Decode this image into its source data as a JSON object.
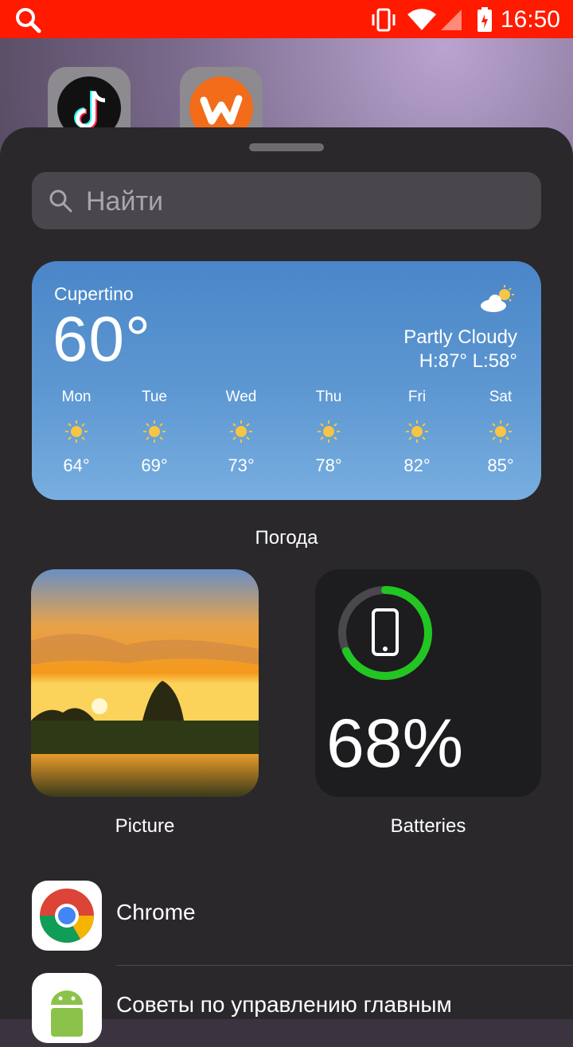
{
  "status_bar": {
    "time": "16:50"
  },
  "search": {
    "placeholder": "Найти"
  },
  "weather": {
    "city": "Cupertino",
    "temp": "60°",
    "condition": "Partly Cloudy",
    "high_low": "H:87° L:58°",
    "forecast": [
      {
        "day": "Mon",
        "temp": "64°"
      },
      {
        "day": "Tue",
        "temp": "69°"
      },
      {
        "day": "Wed",
        "temp": "73°"
      },
      {
        "day": "Thu",
        "temp": "78°"
      },
      {
        "day": "Fri",
        "temp": "82°"
      },
      {
        "day": "Sat",
        "temp": "85°"
      }
    ],
    "label": "Погода"
  },
  "widgets": {
    "picture_label": "Picture",
    "battery_label": "Batteries",
    "battery_percent": "68%",
    "battery_level": 0.68
  },
  "apps": [
    {
      "name": "Chrome"
    },
    {
      "name": "Советы по управлению главным"
    }
  ],
  "colors": {
    "status_bar": "#ff1a00",
    "battery_ring": "#22c522",
    "weather_bg": "#4a86c8"
  }
}
